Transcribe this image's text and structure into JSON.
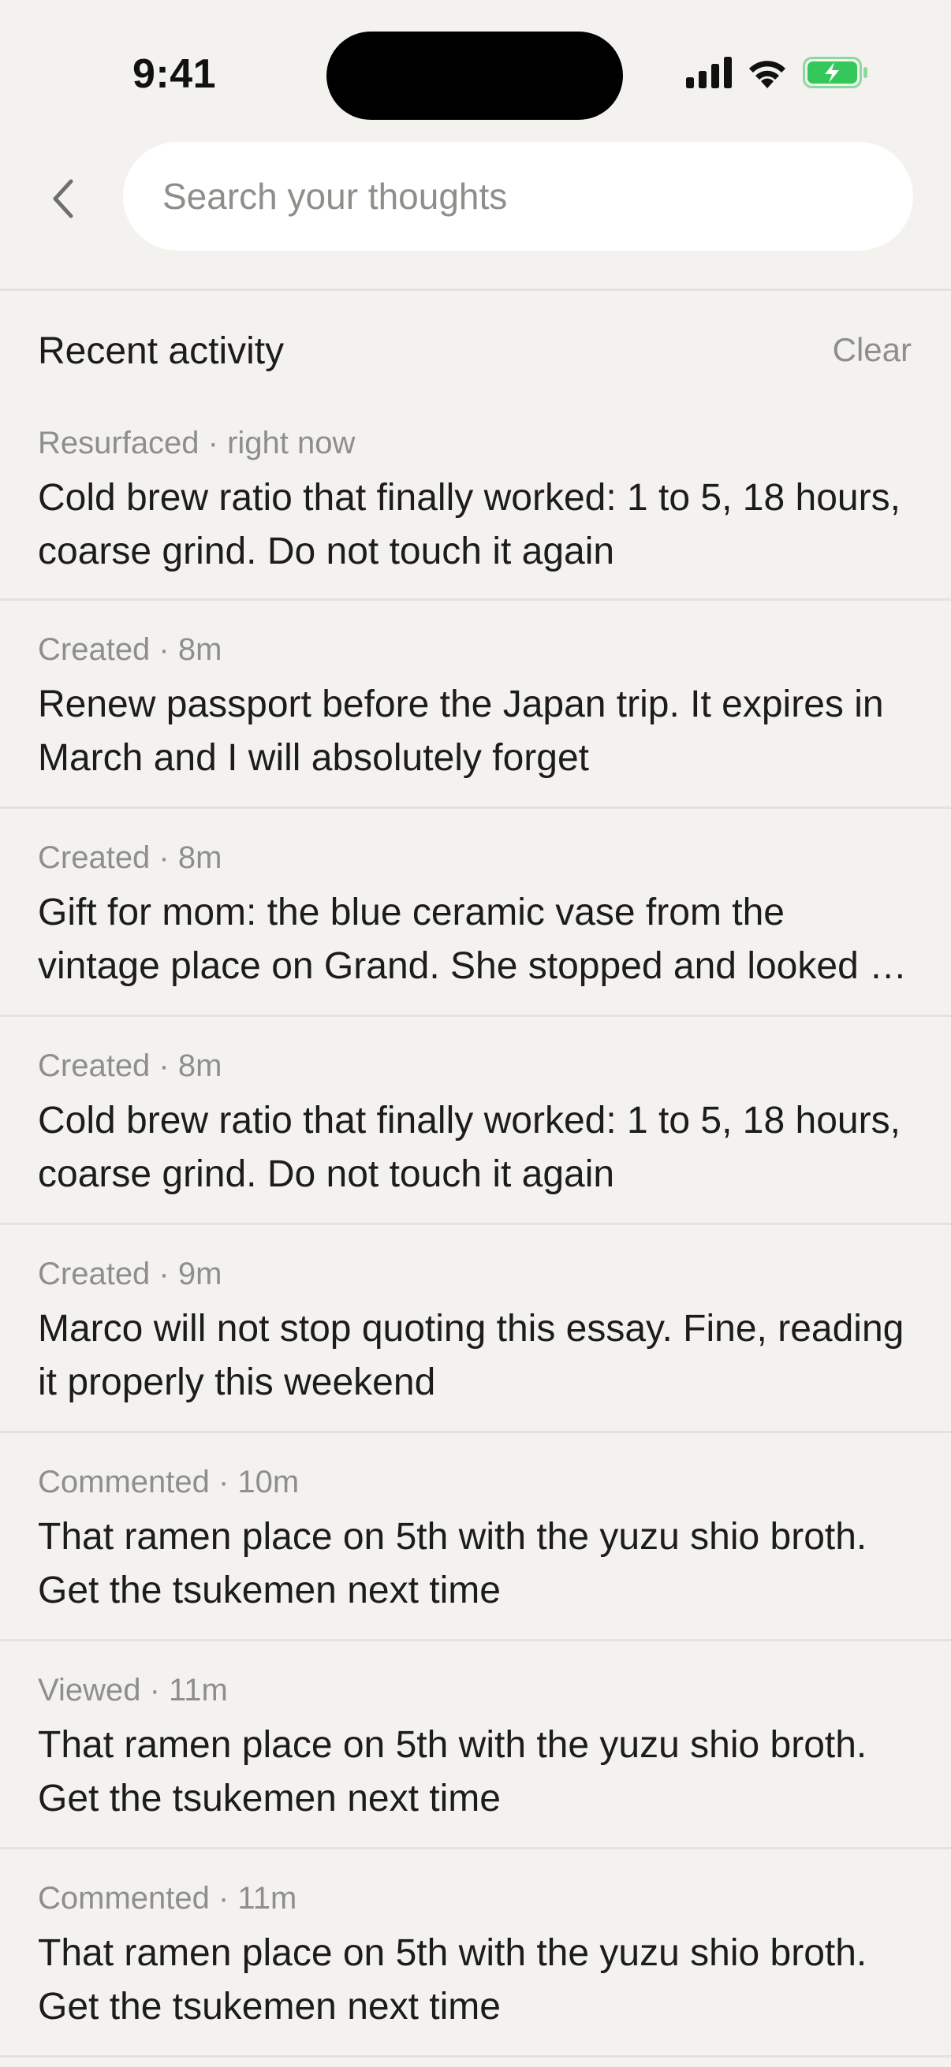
{
  "status_bar": {
    "time": "9:41",
    "icons": [
      "cellular-signal-icon",
      "wifi-icon",
      "battery-charging-icon"
    ],
    "battery_color": "#34c759"
  },
  "search": {
    "placeholder": "Search your thoughts",
    "value": ""
  },
  "back": {
    "icon": "chevron-left-icon"
  },
  "recent": {
    "title": "Recent activity",
    "clear_label": "Clear"
  },
  "colors": {
    "background": "#f3f2ef",
    "search_background": "#ffffff",
    "meta_text": "#8e8e8b",
    "primary_text": "#1c1c1c"
  },
  "items": [
    {
      "action": "Resurfaced",
      "time": "right now",
      "meta": "Resurfaced · right now",
      "text": "Cold brew ratio that finally worked: 1 to 5, 18 hours, coarse grind. Do not touch it again"
    },
    {
      "action": "Created",
      "time": "8m",
      "meta": "Created · 8m",
      "text": "Renew passport before the Japan trip. It expires in March and I will absolutely forget"
    },
    {
      "action": "Created",
      "time": "8m",
      "meta": "Created · 8m",
      "text": "Gift for mom: the blue ceramic vase from the vintage place on Grand. She stopped and looked at it twice"
    },
    {
      "action": "Created",
      "time": "8m",
      "meta": "Created · 8m",
      "text": "Cold brew ratio that finally worked: 1 to 5, 18 hours, coarse grind. Do not touch it again"
    },
    {
      "action": "Created",
      "time": "9m",
      "meta": "Created · 9m",
      "text": "Marco will not stop quoting this essay. Fine, reading it properly this weekend"
    },
    {
      "action": "Commented",
      "time": "10m",
      "meta": "Commented · 10m",
      "text": "That ramen place on 5th with the yuzu shio broth. Get the tsukemen next time"
    },
    {
      "action": "Viewed",
      "time": "11m",
      "meta": "Viewed · 11m",
      "text": "That ramen place on 5th with the yuzu shio broth. Get the tsukemen next time"
    },
    {
      "action": "Commented",
      "time": "11m",
      "meta": "Commented · 11m",
      "text": "That ramen place on 5th with the yuzu shio broth. Get the tsukemen next time"
    }
  ]
}
